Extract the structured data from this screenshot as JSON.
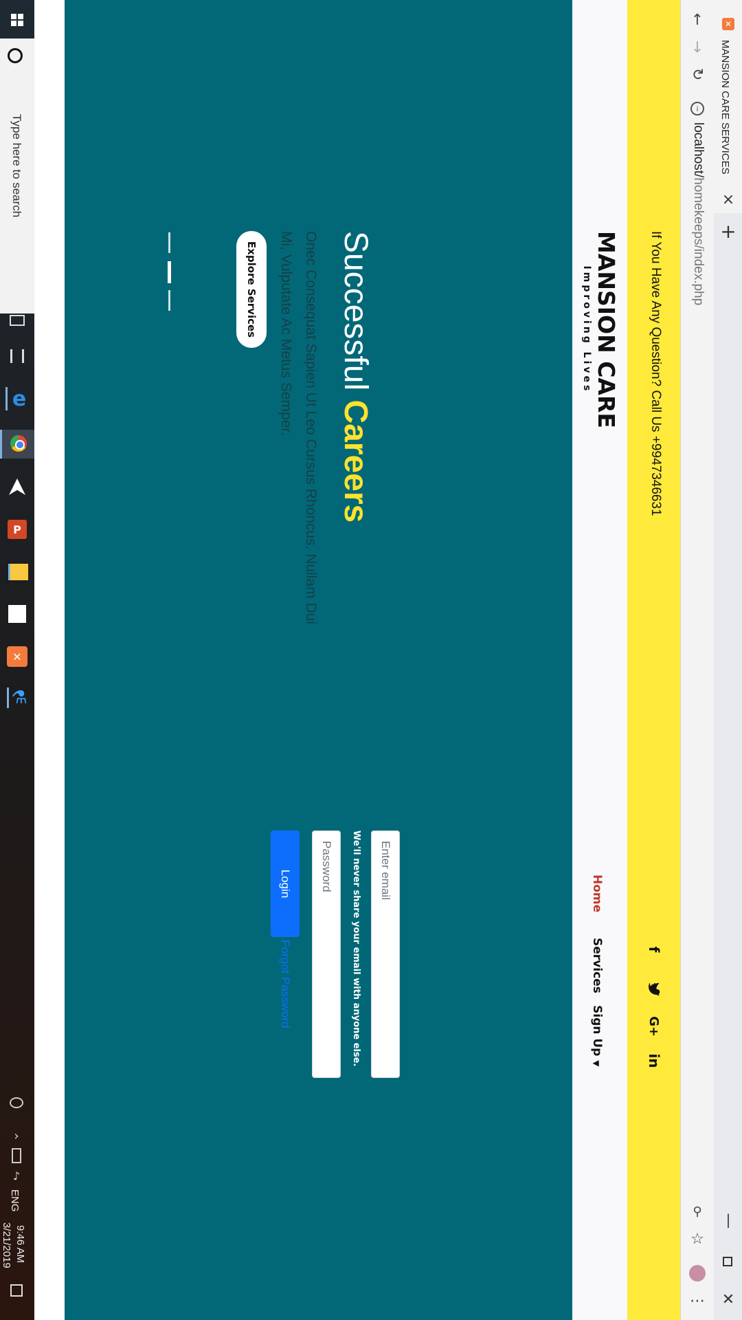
{
  "browser": {
    "tab_title": "MANSION CARE SERVICES",
    "url_host": "localhost/",
    "url_path": "homekeeps/index.php",
    "new_tab_symbol": "+",
    "close_tab_symbol": "×"
  },
  "taskbar": {
    "search_placeholder": "Type here to search",
    "time": "9:46 AM",
    "date": "3/21/2019",
    "language": "ENG"
  },
  "topbar": {
    "contact_text": "If You Have Any Question? Call Us +9947346631",
    "social": [
      "f",
      "twitter",
      "G+",
      "in"
    ]
  },
  "brand": {
    "name": "MANSION CARE",
    "tagline": "Improving Lives"
  },
  "nav": {
    "items": [
      "Home",
      "Services",
      "Sign Up"
    ],
    "active": "Home"
  },
  "hero": {
    "title_plain": "Successful ",
    "title_accent": "Careers",
    "description": "Onec Consequat Sapien Ut Leo Cursus Rhoncus. Nullam Dui Mi, Vulputate Ac Metus Semper.",
    "button": "Explore Services"
  },
  "login": {
    "email_placeholder": "Enter email",
    "email_help": "We'll never share your email with anyone else.",
    "password_placeholder": "Password",
    "button": "Login",
    "forgot": "Forgot Password"
  },
  "colors": {
    "topbar": "#ffea3c",
    "hero_bg": "#026877",
    "accent": "#ffe22e",
    "nav_active": "#c0392b",
    "primary_button": "#0d6efd"
  }
}
